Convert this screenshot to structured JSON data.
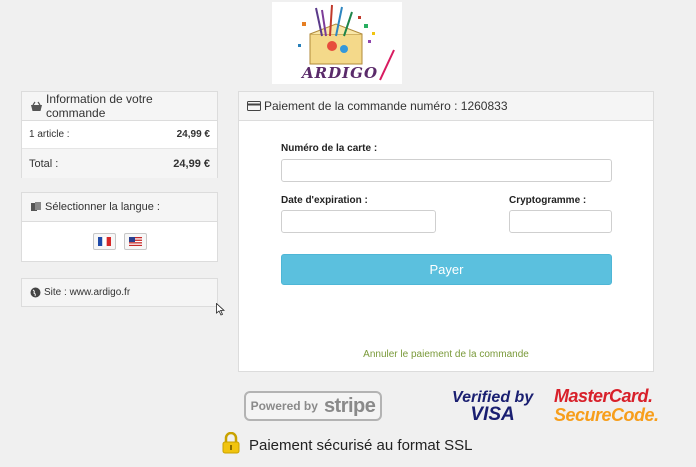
{
  "logo": {
    "text": "ARDIGO"
  },
  "order": {
    "title": "Information de votre commande",
    "article_label": "1 article :",
    "article_value": "24,99 €",
    "total_label": "Total :",
    "total_value": "24,99 €"
  },
  "language": {
    "title": "Sélectionner la langue :",
    "options": [
      "fr",
      "en"
    ]
  },
  "site": {
    "label": "Site : www.ardigo.fr"
  },
  "payment": {
    "title": "Paiement de la commande numéro : 1260833",
    "card_number_label": "Numéro de la carte :",
    "card_number_value": "",
    "expiry_label": "Date d'expiration :",
    "expiry_value": "",
    "cvc_label": "Cryptogramme :",
    "cvc_value": "",
    "pay_button": "Payer",
    "cancel_link": "Annuler le paiement de la commande"
  },
  "badges": {
    "stripe_powered": "Powered by",
    "stripe_name": "stripe",
    "visa_line1": "Verified by",
    "visa_line2": "VISA",
    "mc_line1": "MasterCard.",
    "mc_line2": "SecureCode."
  },
  "ssl": {
    "text": "Paiement sécurisé au format SSL"
  },
  "colors": {
    "accent": "#5bc0de",
    "link": "#7a9a3a",
    "visa": "#1a1f71",
    "mc_red": "#d8202a",
    "mc_orange": "#f79e1b"
  }
}
